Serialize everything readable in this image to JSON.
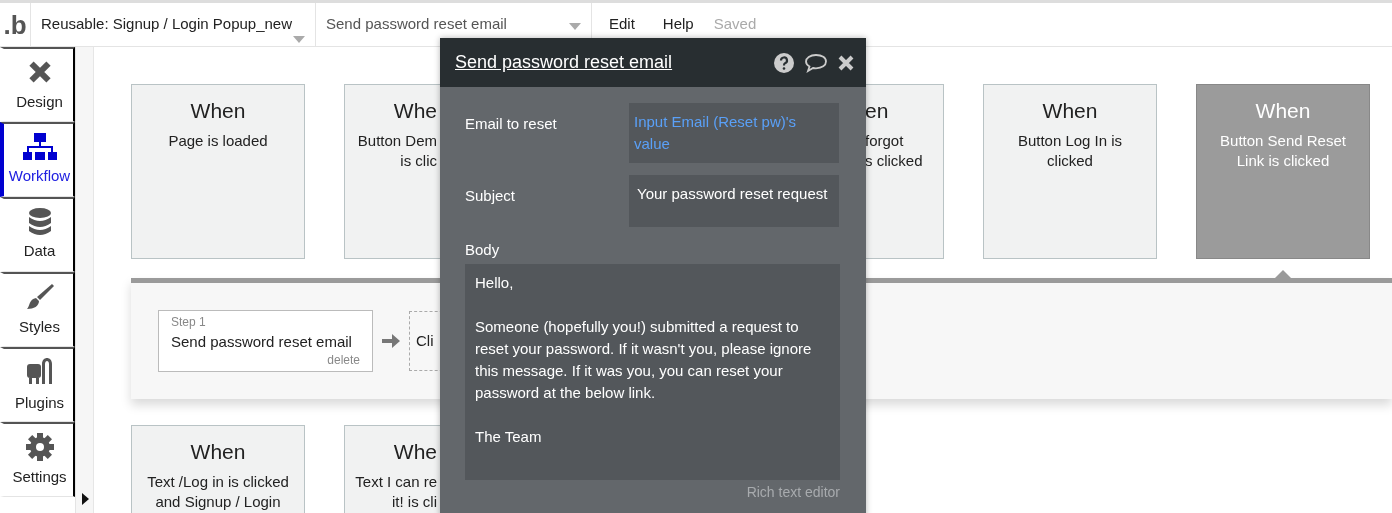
{
  "topbar": {
    "logo": ".b",
    "page_selector": "Reusable: Signup / Login Popup_new",
    "workflow_selector": "Send password reset email",
    "menu": [
      "Edit",
      "Help"
    ],
    "status": "Saved"
  },
  "sidebar": {
    "items": [
      {
        "label": "Design",
        "kind": "design",
        "selected": false
      },
      {
        "label": "Workflow",
        "kind": "workflow",
        "selected": true
      },
      {
        "label": "Data",
        "kind": "data",
        "selected": false
      },
      {
        "label": "Styles",
        "kind": "styles",
        "selected": false
      },
      {
        "label": "Plugins",
        "kind": "plugins",
        "selected": false
      },
      {
        "label": "Settings",
        "kind": "settings",
        "selected": false
      }
    ]
  },
  "events_row_1": [
    {
      "kind": "full",
      "title": "When",
      "lines": [
        "Page is loaded"
      ],
      "selected": false
    },
    {
      "kind": "cut-right",
      "title": "Whe",
      "lines": [
        "Button Dem",
        "is clic"
      ],
      "selected": false
    },
    {
      "kind": "cut-left",
      "title": "en",
      "lines": [
        "forgot",
        "s clicked"
      ],
      "selected": false
    },
    {
      "kind": "full",
      "title": "When",
      "lines": [
        "Button Log In is clicked"
      ],
      "selected": false
    },
    {
      "kind": "full",
      "title": "When",
      "lines": [
        "Button Send Reset Link is clicked"
      ],
      "selected": true
    }
  ],
  "actions": {
    "steps": [
      {
        "kind": "step",
        "step": "Step 1",
        "name": "Send password reset email",
        "delete": "delete"
      },
      {
        "kind": "add",
        "name": "Cli"
      }
    ]
  },
  "events_row_2": [
    {
      "kind": "full",
      "title": "When",
      "lines": [
        "Text /Log in is clicked and Signup / Login"
      ],
      "selected": false
    },
    {
      "kind": "cut-right",
      "title": "Whe",
      "lines": [
        "Text I can re",
        "it! is cli"
      ],
      "selected": false
    }
  ],
  "popup": {
    "title": "Send password reset email",
    "fields": [
      {
        "label": "Email to reset",
        "value": "Input Email (Reset pw)'s value",
        "kind": "dynamic"
      },
      {
        "label": "Subject",
        "value": "Your password reset request",
        "kind": "static"
      }
    ],
    "body_label": "Body",
    "body": [
      "Hello,",
      "Someone (hopefully you!) submitted a request to reset your password. If it wasn't you, please ignore this message. If it was you, you can reset your password at the below link.",
      "The Team"
    ],
    "editor_link": "Rich text editor"
  }
}
